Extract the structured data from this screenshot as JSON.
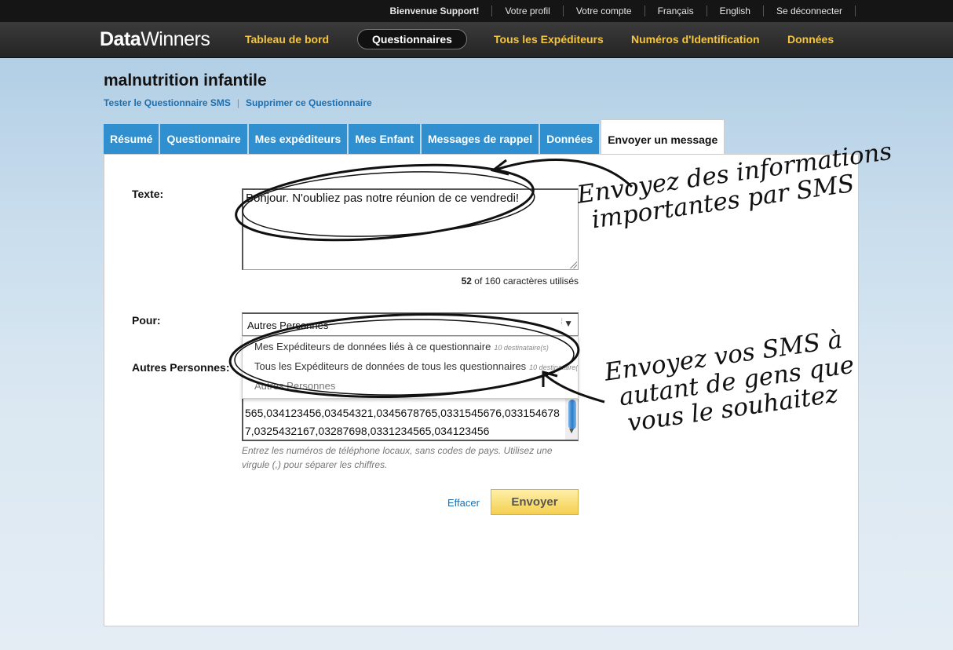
{
  "userbar": {
    "welcome": "Bienvenue Support!",
    "profile": "Votre profil",
    "account": "Votre compte",
    "lang_fr": "Français",
    "lang_en": "English",
    "logout": "Se déconnecter"
  },
  "nav": {
    "logo_bold": "Data",
    "logo_light": "Winners",
    "items": [
      "Tableau de bord",
      "Questionnaires",
      "Tous les Expéditeurs",
      "Numéros d'Identification",
      "Données"
    ],
    "active": "Questionnaires"
  },
  "page": {
    "title": "malnutrition infantile",
    "link_test": "Tester le Questionnaire SMS",
    "link_delete": "Supprimer ce Questionnaire"
  },
  "tabs": [
    "Résumé",
    "Questionnaire",
    "Mes expéditeurs",
    "Mes Enfant",
    "Messages de rappel",
    "Données",
    "Envoyer un message"
  ],
  "form": {
    "text_label": "Texte:",
    "text_value": "Bonjour. N'oubliez pas notre réunion de ce vendredi!",
    "count_used": "52",
    "count_rest": "of 160 caractères utilisés",
    "to_label": "Pour:",
    "to_selected": "Autres Personnes",
    "options": [
      {
        "label": "Mes Expéditeurs de données liés à ce questionnaire",
        "count": "10 destinataire(s)"
      },
      {
        "label": "Tous les Expéditeurs de données de tous les questionnaires",
        "count": "10 destinataire(s)"
      },
      {
        "label": "Autres Personnes",
        "count": ""
      }
    ],
    "others_label": "Autres Personnes:",
    "numbers_value": "565,034123456,03454321,0345678765,0331545676,0331546787,0325432167,03287698,0331234565,034123456",
    "hint": "Entrez les numéros de téléphone locaux, sans codes de pays. Utilisez une virgule (,) pour séparer les chiffres.",
    "cancel": "Effacer",
    "send": "Envoyer"
  },
  "annotations": {
    "a1_line1": "Envoyez des informations",
    "a1_line2": "importantes par SMS",
    "a2_line1": "Envoyez vos SMS à",
    "a2_line2": "autant de gens que",
    "a2_line3": "vous le souhaitez"
  },
  "colors": {
    "nav_text": "#f4c542",
    "tab_bg": "#2f8fcf",
    "link": "#1c6fb0",
    "send_button": "#f4cf50"
  }
}
